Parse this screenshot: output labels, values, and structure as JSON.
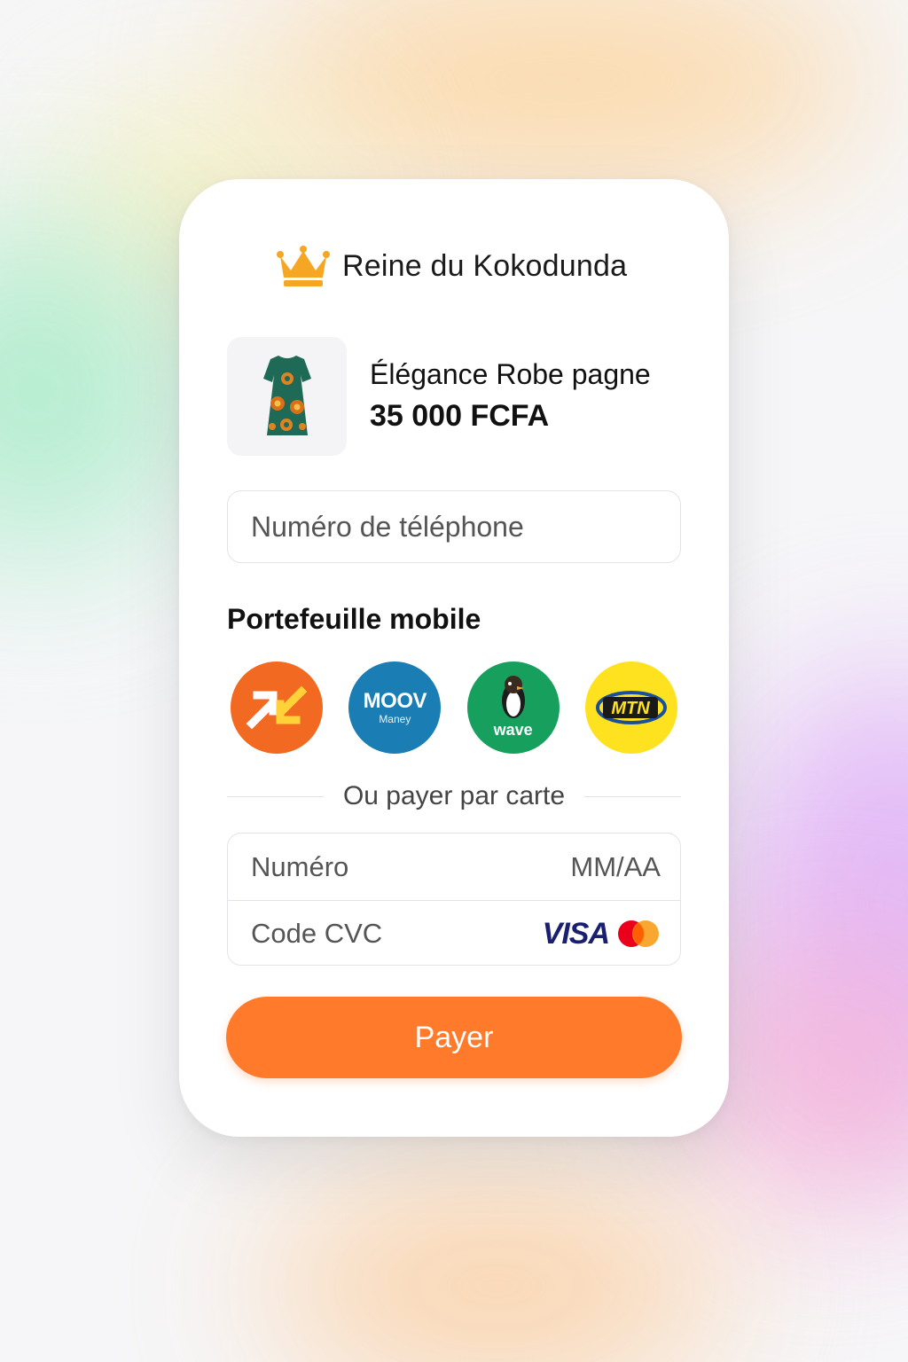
{
  "brand": {
    "name": "Reine du Kokodunda",
    "icon": "crown-icon",
    "icon_color": "#f5a623"
  },
  "product": {
    "name": "Élégance Robe pagne",
    "price": "35 000 FCFA",
    "image": "dress-icon"
  },
  "phone": {
    "placeholder": "Numéro de téléphone",
    "value": ""
  },
  "wallets": {
    "title": "Portefeuille mobile",
    "items": [
      {
        "name": "Orange Money",
        "icon": "orange-money-icon",
        "color": "#f26a21"
      },
      {
        "name": "MOOV",
        "sub": "Maney",
        "icon": "moov-money-icon",
        "color": "#1a7db3"
      },
      {
        "name": "wave",
        "icon": "wave-icon",
        "color": "#17a05d"
      },
      {
        "name": "MTN",
        "icon": "mtn-money-icon",
        "color": "#ffe21f"
      }
    ]
  },
  "divider": {
    "text": "Ou payer par carte"
  },
  "card": {
    "number_placeholder": "Numéro",
    "expiry_placeholder": "MM/AA",
    "cvc_placeholder": "Code CVC",
    "brands": [
      "VISA",
      "mastercard-icon"
    ]
  },
  "pay_button": {
    "label": "Payer",
    "color": "#ff7a2a"
  }
}
